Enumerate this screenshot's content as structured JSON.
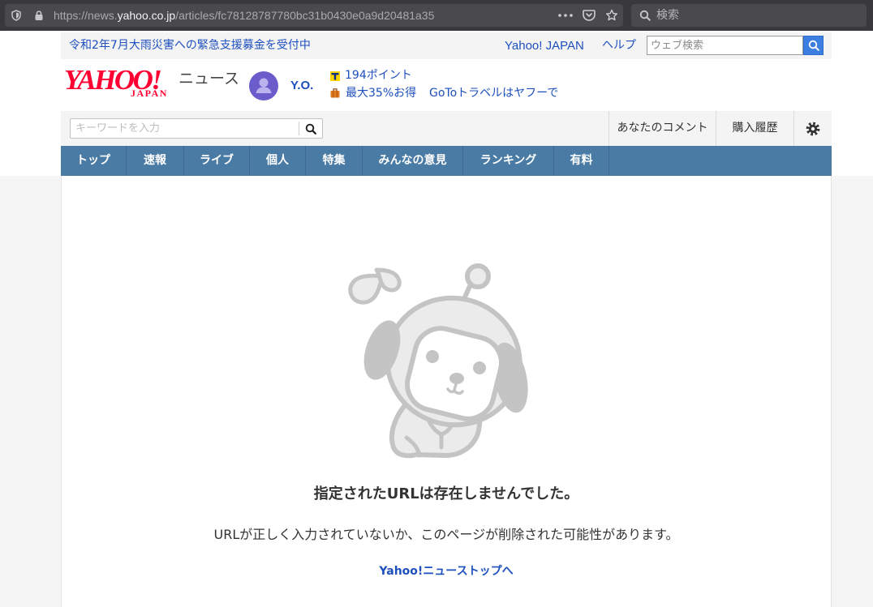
{
  "browser": {
    "url_prefix": "https://news.",
    "url_domain": "yahoo.co.jp",
    "url_path": "/articles/fc78128787780bc31b0430e0a9d20481a35",
    "search_placeholder": "検索",
    "icons": [
      "shield-icon",
      "lock-icon",
      "more-actions-icon",
      "pocket-icon",
      "star-icon",
      "search-icon"
    ]
  },
  "topbar": {
    "notice": "令和2年7月大雨災害への緊急支援募金を受付中",
    "yahoo_japan_link": "Yahoo! JAPAN",
    "help_link": "ヘルプ",
    "search_placeholder": "ウェブ検索",
    "search_button_icon": "search-icon"
  },
  "header": {
    "logo_main": "YAHOO!",
    "logo_sub": "JAPAN",
    "service_name": "ニュース",
    "avatar_icon": "user-avatar-icon",
    "user_name": "Y.O.",
    "points_icon": "tpoint-icon",
    "points": "194ポイント",
    "promo_icon": "suitcase-icon",
    "promo_discount": "最大35%お得",
    "promo_campaign": "GoToトラベルはヤフーで"
  },
  "subheader": {
    "search_placeholder": "キーワードを入力",
    "search_icon": "search-icon",
    "comments_link": "あなたのコメント",
    "history_link": "購入履歴",
    "settings_icon": "gear-icon"
  },
  "nav": {
    "tabs": [
      "トップ",
      "速報",
      "ライブ",
      "個人",
      "特集",
      "みんなの意見",
      "ランキング",
      "有料"
    ]
  },
  "error": {
    "illustration": "error-mascot-illustration",
    "title": "指定されたURLは存在しませんでした。",
    "message": "URLが正しく入力されていないか、このページが削除された可能性があります。",
    "top_link": "Yahoo!ニューストップへ"
  },
  "colors": {
    "link": "#1d4fbd",
    "brand-red": "#ff0033",
    "nav-bg": "#4a7ba5",
    "search-button": "#3d7fe0",
    "avatar": "#6a5ccb",
    "mascot-line": "#c4c4c4"
  }
}
